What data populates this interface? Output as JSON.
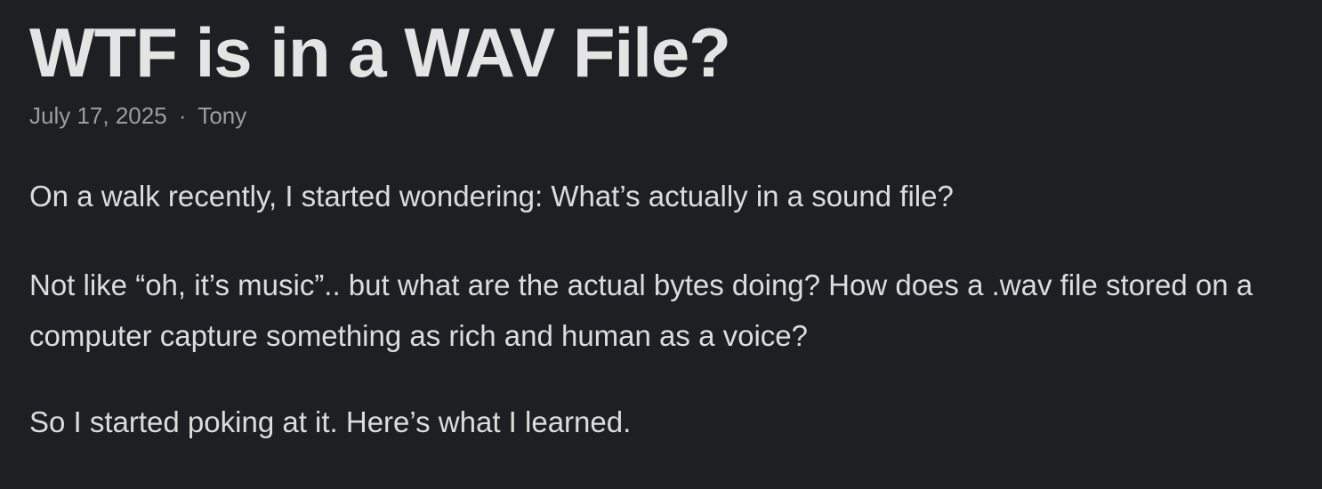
{
  "article": {
    "title": "WTF is in a WAV File?",
    "date": "July 17, 2025",
    "separator": "·",
    "author": "Tony",
    "paragraphs": [
      "On a walk recently, I started wondering: What’s actually in a sound file?",
      "Not like “oh, it’s music”.. but what are the actual bytes doing? How does a .wav file stored on a computer capture something as rich and human as a voice?",
      "So I started poking at it. Here’s what I learned."
    ]
  },
  "colors": {
    "background": "#1e1f22",
    "title": "#e4e4e4",
    "meta": "#9d9d9f",
    "body": "#dcdcdc"
  }
}
